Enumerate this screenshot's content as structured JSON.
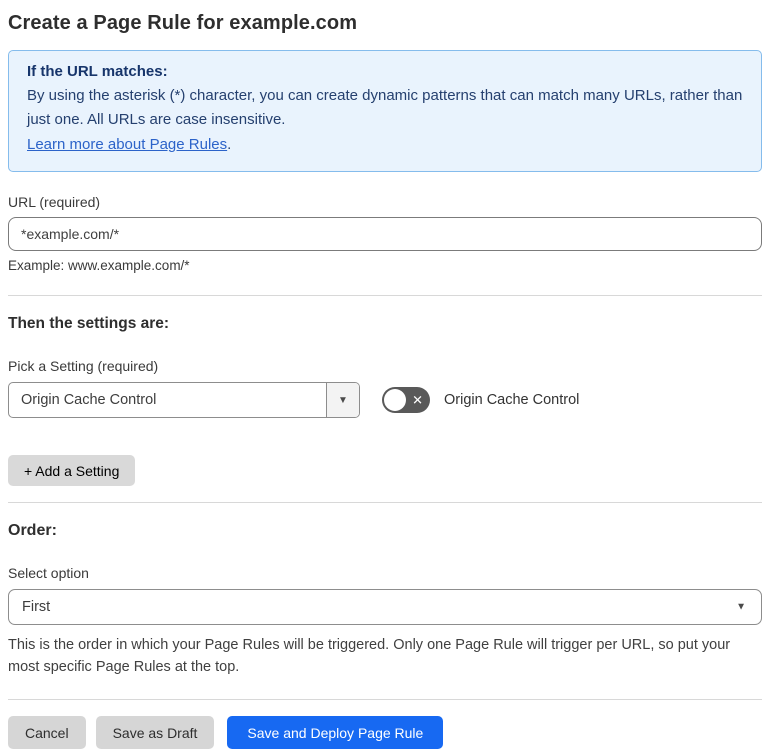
{
  "page": {
    "title": "Create a Page Rule for example.com"
  },
  "info_box": {
    "heading": "If the URL matches:",
    "body": "By using the asterisk (*) character, you can create dynamic patterns that can match many URLs, rather than just one. All URLs are case insensitive.",
    "link_label": "Learn more about Page Rules",
    "link_suffix": "."
  },
  "url_field": {
    "label": "URL (required)",
    "value": "*example.com/*",
    "helper": "Example: www.example.com/*"
  },
  "settings_section": {
    "heading": "Then the settings are:",
    "picker_label": "Pick a Setting (required)",
    "picker_value": "Origin Cache Control",
    "toggle_state": "off",
    "toggle_label": "Origin Cache Control",
    "add_setting_button": "+ Add a Setting"
  },
  "order_section": {
    "heading": "Order:",
    "select_label": "Select option",
    "select_value": "First",
    "helper": "This is the order in which your Page Rules will be triggered. Only one Page Rule will trigger per URL, so put your most specific Page Rules at the top."
  },
  "footer": {
    "cancel_label": "Cancel",
    "save_draft_label": "Save as Draft",
    "save_deploy_label": "Save and Deploy Page Rule"
  },
  "icons": {
    "dropdown_arrow": "▼",
    "toggle_off_x": "✕"
  },
  "colors": {
    "accent_blue": "#1769f2",
    "info_bg": "#e9f3fd",
    "info_border": "#85bcec",
    "info_text": "#25406f",
    "link_blue": "#2c63c9",
    "toggle_off_bg": "#595959",
    "gray_button_bg": "#d6d6d6"
  }
}
